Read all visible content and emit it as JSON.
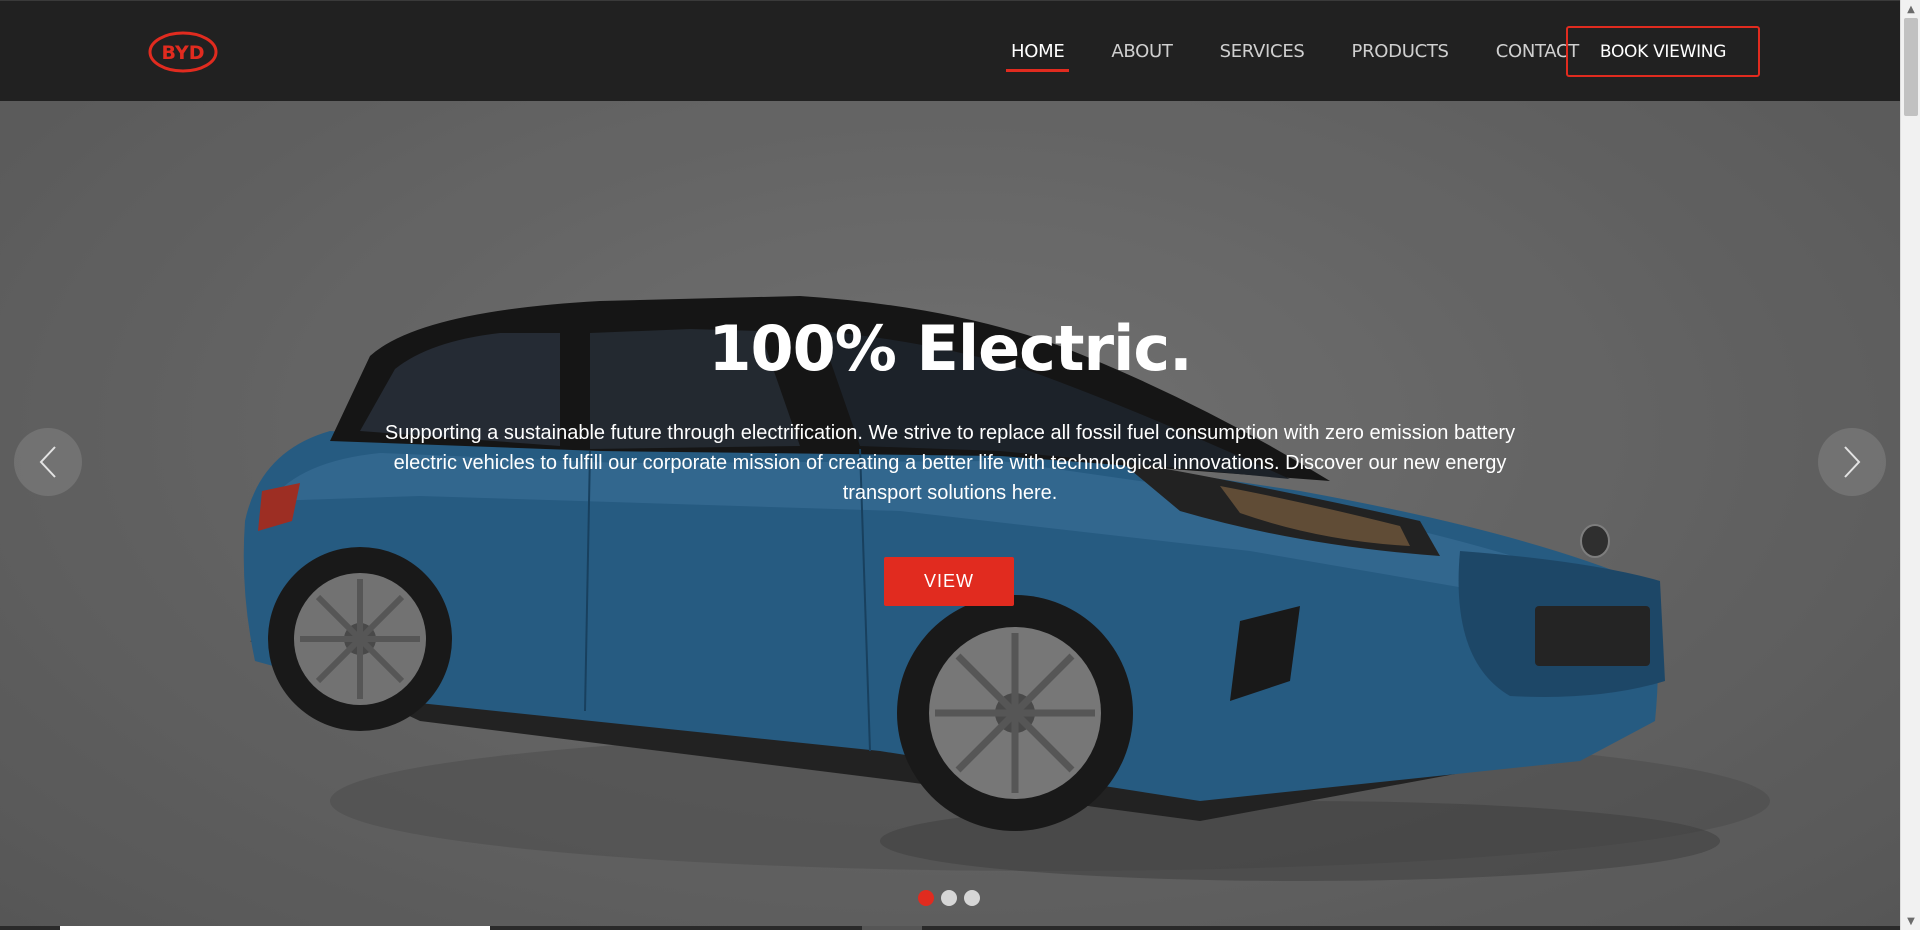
{
  "brand": {
    "logo_text": "BYD",
    "accent_color": "#e12b1f",
    "header_bg": "#212121"
  },
  "nav": {
    "items": [
      {
        "label": "HOME",
        "active": true
      },
      {
        "label": "ABOUT",
        "active": false
      },
      {
        "label": "SERVICES",
        "active": false
      },
      {
        "label": "PRODUCTS",
        "active": false
      },
      {
        "label": "CONTACT",
        "active": false
      }
    ],
    "cta_label": "BOOK VIEWING"
  },
  "hero": {
    "title": "100% Electric.",
    "description": "Supporting a sustainable future through electrification. We strive to replace all fossil fuel consumption with zero emission battery electric vehicles to fulfill our corporate mission of creating a better life with technological innovations. Discover our new energy transport solutions here.",
    "button_label": "VIEW",
    "prev_icon": "chevron-left-icon",
    "next_icon": "chevron-right-icon",
    "car_color": "#2f6f9e"
  },
  "carousel": {
    "slide_count": 3,
    "active_index": 0
  }
}
